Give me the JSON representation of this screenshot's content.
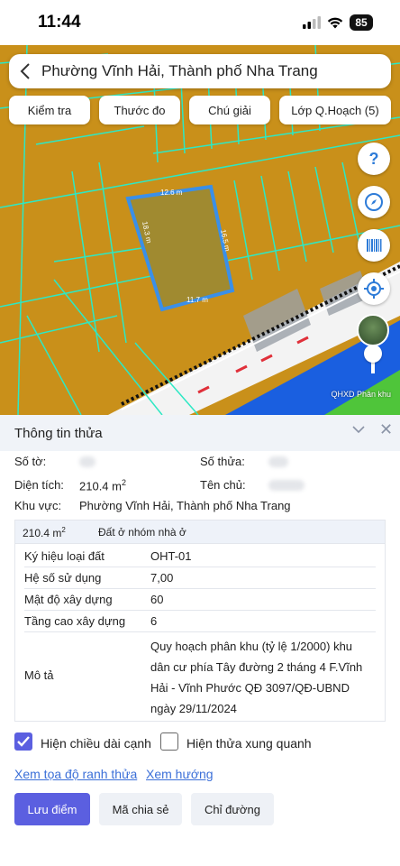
{
  "status": {
    "time": "11:44",
    "battery": "85"
  },
  "header": {
    "title": "Phường Vĩnh Hải, Thành phố Nha Trang"
  },
  "toolbar": {
    "check": "Kiểm tra",
    "ruler": "Thước đo",
    "legend": "Chú giải",
    "layers": "Lớp Q.Hoạch (5)"
  },
  "map": {
    "dims": {
      "top": "12.6 m",
      "right": "16.5 m",
      "left": "18.3 m",
      "bottom": "11.7 m"
    },
    "credit": "QHXD Phân khu",
    "colors": {
      "land": "#c9901a",
      "parcel_line": "#2de8c4",
      "selected": "#3a8fe8",
      "water": "#1a5fe0",
      "green": "#4fc53a"
    }
  },
  "panel": {
    "title": "Thông tin thửa",
    "so_to_label": "Số tờ:",
    "so_thua_label": "Số thửa:",
    "dien_tich_label": "Diện tích:",
    "dien_tich_value": "210.4 m",
    "dien_tich_sup": "2",
    "ten_chu_label": "Tên chủ:",
    "khu_vuc_label": "Khu vực:",
    "khu_vuc_value": "Phường Vĩnh Hải, Thành phố Nha Trang",
    "sub": {
      "area": "210.4 m",
      "area_sup": "2",
      "land_type": "Đất ở nhóm nhà ở",
      "rows": [
        {
          "label": "Ký hiệu loại đất",
          "value": "OHT-01"
        },
        {
          "label": "Hệ số sử dụng",
          "value": "7,00"
        },
        {
          "label": "Mật độ xây dựng",
          "value": "60"
        },
        {
          "label": "Tầng cao xây dựng",
          "value": "6"
        }
      ],
      "desc_label": "Mô tả",
      "desc_lines": [
        "Quy hoạch phân khu (tỷ lệ 1/2000) khu",
        "dân cư phía Tây đường 2 tháng 4 F.Vĩnh",
        "Hải - Vĩnh Phước QĐ 3097/QĐ-UBND",
        "ngày 29/11/2024"
      ]
    },
    "check_edges": "Hiện chiều dài cạnh",
    "check_neighbors": "Hiện thửa xung quanh",
    "link_coords": "Xem tọa độ ranh thửa",
    "link_direction": "Xem hướng",
    "btn_save": "Lưu điểm",
    "btn_share": "Mã chia sẻ",
    "btn_route": "Chỉ đường"
  }
}
